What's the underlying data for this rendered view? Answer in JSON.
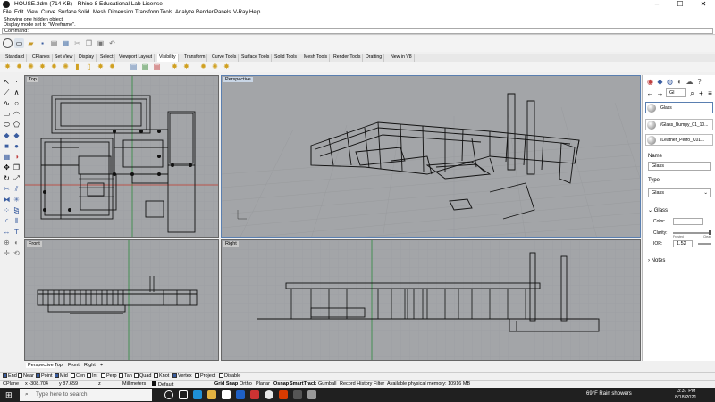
{
  "window": {
    "title": "HOUSE.3dm (714 KB) - Rhino 8 Educational Lab License",
    "controls": [
      "–",
      "☐",
      "✕"
    ]
  },
  "menu": [
    "File",
    "Edit",
    "View",
    "Curve",
    "Surface",
    "Solid",
    "Mesh",
    "Dimension",
    "Transform",
    "Tools",
    "Analyze",
    "Render",
    "Panels",
    "V-Ray",
    "Help"
  ],
  "command_history": [
    "Showing one hidden object.",
    "Display mode set to \"Wireframe\"."
  ],
  "command_prompt": "Command:",
  "toolbar_tabs": [
    "Standard",
    "CPlanes",
    "Set View",
    "Display",
    "Select",
    "Viewport Layout",
    "Visibility",
    "Transform",
    "Curve Tools",
    "Surface Tools",
    "Solid Tools",
    "Mesh Tools",
    "Render Tools",
    "Drafting",
    "New in V8"
  ],
  "active_toolbar_tab": "Visibility",
  "viewports": {
    "top": "Top",
    "perspective": "Perspective",
    "front": "Front",
    "right": "Right"
  },
  "viewport_tabs": [
    "Perspective",
    "Top",
    "Front",
    "Right"
  ],
  "viewport_add": "+",
  "snaps": [
    {
      "label": "End",
      "checked": true
    },
    {
      "label": "Near",
      "checked": false
    },
    {
      "label": "Point",
      "checked": true
    },
    {
      "label": "Mid",
      "checked": true
    },
    {
      "label": "Cen",
      "checked": false
    },
    {
      "label": "Int",
      "checked": false
    },
    {
      "label": "Perp",
      "checked": false
    },
    {
      "label": "Tan",
      "checked": false
    },
    {
      "label": "Quad",
      "checked": false
    },
    {
      "label": "Knot",
      "checked": false
    },
    {
      "label": "Vertex",
      "checked": true
    },
    {
      "label": "Project",
      "checked": false
    },
    {
      "label": "Disable",
      "checked": false
    }
  ],
  "status": {
    "cplane": "CPlane",
    "x": "x -308.704",
    "y": "y 87.659",
    "z": "z",
    "units": "Millimeters",
    "layer": "Default",
    "grid_snap": "Grid Snap",
    "ortho": "Ortho",
    "planar": "Planar",
    "osnap": "Osnap",
    "smarttrack": "SmartTrack",
    "gumball": "Gumball",
    "record_history": "Record History",
    "filter": "Filter",
    "memory": "Available physical memory: 10916 MB"
  },
  "panel": {
    "search_value": "Gl",
    "materials": [
      "Glass",
      "/Glass_Bumpy_01_10...",
      "/Leather_Perfo_C01..."
    ],
    "name_label": "Name",
    "name_value": "Glass",
    "type_label": "Type",
    "type_value": "Glass",
    "glass_section": "Glass",
    "color_label": "Color:",
    "clarity_label": "Clarity:",
    "clarity_min": "Frosted",
    "clarity_max": "Clear",
    "ior_label": "IOR:",
    "ior_value": "1.52",
    "notes_section": "Notes"
  },
  "taskbar": {
    "search_placeholder": "Type here to search",
    "weather": "69°F  Rain showers",
    "time": "3:37 PM",
    "date": "8/18/2021"
  },
  "colors": {
    "viewport_bg": "#a3a5a8",
    "grid": "#9a9c9f",
    "axis_x": "#c0392b",
    "axis_y": "#2e8b3e",
    "active_viewport_border": "#5a7fb0",
    "taskbar": "#202020"
  }
}
